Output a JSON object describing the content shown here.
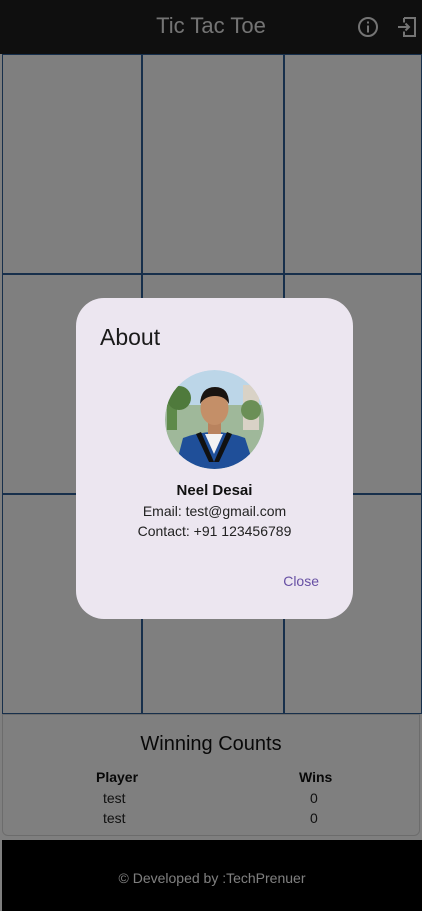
{
  "appbar": {
    "title": "Tic Tac Toe"
  },
  "counts": {
    "title": "Winning Counts",
    "headers": {
      "player": "Player",
      "wins": "Wins"
    },
    "rows": [
      {
        "player": "test",
        "wins": "0"
      },
      {
        "player": "test",
        "wins": "0"
      }
    ]
  },
  "footer": {
    "text": "© Developed by :TechPrenuer"
  },
  "dialog": {
    "title": "About",
    "name": "Neel Desai",
    "email": "Email: test@gmail.com",
    "contact": "Contact: +91 123456789",
    "close_label": "Close"
  },
  "colors": {
    "grid_line": "#2f5f97",
    "dialog_bg": "#ece6f0",
    "accent": "#6750a4"
  },
  "icons": {
    "info": "info-icon",
    "exit": "exit-icon",
    "avatar": "profile-photo"
  }
}
